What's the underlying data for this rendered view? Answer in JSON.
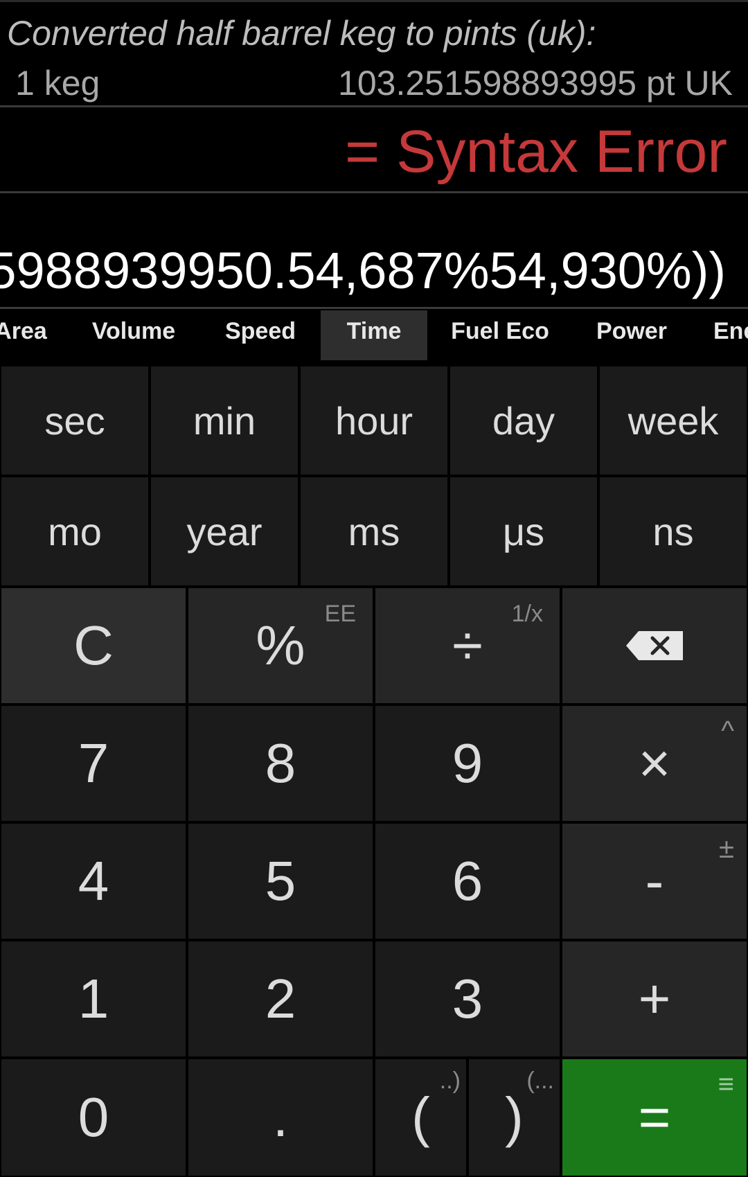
{
  "history": {
    "title": "Converted half barrel keg to pints (uk):",
    "input": "1 keg",
    "output": "103.251598893995 pt UK"
  },
  "result": "= Syntax Error",
  "expression": "5988939950.54,687%54,930%))",
  "tabs": [
    "Area",
    "Volume",
    "Speed",
    "Time",
    "Fuel Eco",
    "Power",
    "Ene"
  ],
  "active_tab": "Time",
  "units_row1": [
    "sec",
    "min",
    "hour",
    "day",
    "week"
  ],
  "units_row2": [
    "mo",
    "year",
    "ms",
    "μs",
    "ns"
  ],
  "keys": {
    "clear": "C",
    "percent": "%",
    "percent_alt": "EE",
    "divide": "÷",
    "divide_alt": "1/x",
    "multiply": "×",
    "multiply_alt": "^",
    "minus": "-",
    "minus_alt": "±",
    "plus": "+",
    "zero": "0",
    "one": "1",
    "two": "2",
    "three": "3",
    "four": "4",
    "five": "5",
    "six": "6",
    "seven": "7",
    "eight": "8",
    "nine": "9",
    "dot": ".",
    "open_paren": "(",
    "open_paren_alt": "..)",
    "close_paren": ")",
    "close_paren_alt": "(...",
    "equals": "=",
    "equals_alt": "≡"
  },
  "colors": {
    "error": "#c5393a",
    "equals_key": "#1a7a1a",
    "background": "#000000"
  }
}
